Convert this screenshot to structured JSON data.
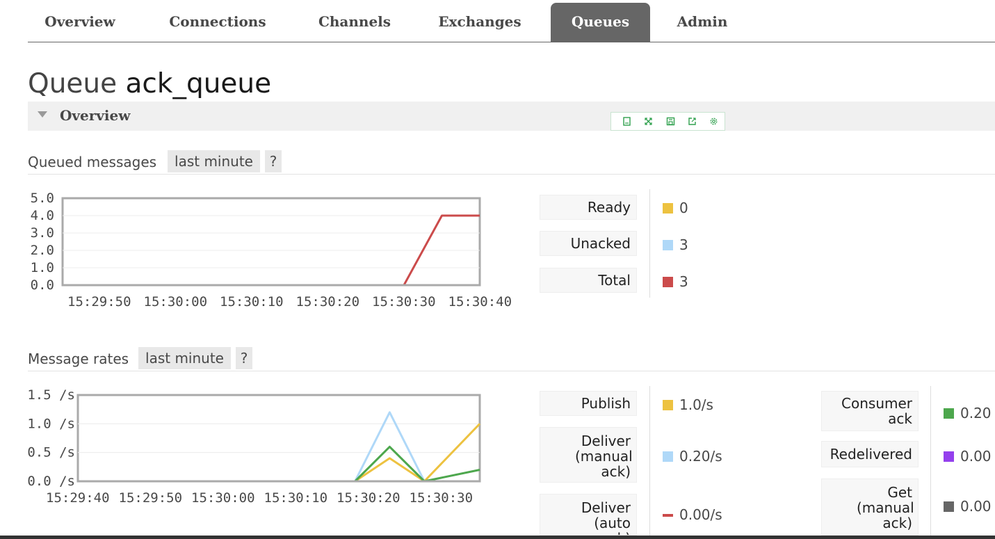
{
  "nav": {
    "tabs": [
      {
        "label": "Overview",
        "active": false
      },
      {
        "label": "Connections",
        "active": false
      },
      {
        "label": "Channels",
        "active": false
      },
      {
        "label": "Exchanges",
        "active": false
      },
      {
        "label": "Queues",
        "active": true
      },
      {
        "label": "Admin",
        "active": false
      }
    ]
  },
  "page": {
    "title_prefix": "Queue",
    "queue_name": "ack_queue"
  },
  "overview": {
    "label": "Overview",
    "toolbox_icons": [
      "data-view-icon",
      "data-zoom-icon",
      "save-image-icon",
      "restore-icon",
      "settings-icon"
    ]
  },
  "queued": {
    "name": "Queued messages",
    "range": "last minute",
    "help": "?",
    "legend": [
      {
        "label": "Ready",
        "value": "0",
        "color": "#edc240"
      },
      {
        "label": "Unacked",
        "value": "3",
        "color": "#afd8f8"
      },
      {
        "label": "Total",
        "value": "3",
        "color": "#cb4b4b"
      }
    ]
  },
  "rates": {
    "name": "Message rates",
    "range": "last minute",
    "help": "?",
    "legend_left": [
      {
        "label": "Publish",
        "value": "1.0/s",
        "color": "#edc240"
      },
      {
        "label": "Deliver (manual ack)",
        "value": "0.20/s",
        "color": "#afd8f8"
      },
      {
        "label": "Deliver (auto ack)",
        "value": "0.00/s",
        "color": "#cb4b4b"
      }
    ],
    "legend_right": [
      {
        "label": "Consumer ack",
        "value": "0.20",
        "color": "#4da74d"
      },
      {
        "label": "Redelivered",
        "value": "0.00",
        "color": "#9440ed"
      },
      {
        "label": "Get (manual ack)",
        "value": "0.00",
        "color": "#666666"
      }
    ]
  },
  "chart_data": [
    {
      "type": "line",
      "title": "Queued messages",
      "x": [
        "15:29:50",
        "15:30:00",
        "15:30:10",
        "15:30:20",
        "15:30:30",
        "15:30:40"
      ],
      "ytick_labels": [
        "0.0",
        "1.0",
        "2.0",
        "3.0",
        "4.0",
        "5.0"
      ],
      "ylim": [
        0,
        5
      ],
      "xlim_seconds": [
        0,
        55
      ],
      "series": [
        {
          "name": "Ready",
          "color": "#edc240",
          "points": [
            [
              0,
              0
            ],
            [
              45,
              0
            ],
            [
              55,
              0
            ]
          ]
        },
        {
          "name": "Total",
          "color": "#cb4b4b",
          "points": [
            [
              0,
              0
            ],
            [
              45,
              0
            ],
            [
              50,
              4
            ],
            [
              55,
              4
            ]
          ]
        }
      ]
    },
    {
      "type": "line",
      "title": "Message rates",
      "x": [
        "15:29:40",
        "15:29:50",
        "15:30:00",
        "15:30:10",
        "15:30:20",
        "15:30:30"
      ],
      "ytick_labels": [
        "0.0 /s",
        "0.5 /s",
        "1.0 /s",
        "1.5 /s"
      ],
      "ylim": [
        0,
        1.5
      ],
      "xlim_seconds": [
        0,
        58
      ],
      "series": [
        {
          "name": "Deliver (manual ack)",
          "color": "#afd8f8",
          "points": [
            [
              0,
              0
            ],
            [
              40,
              0
            ],
            [
              45,
              1.2
            ],
            [
              50,
              0
            ],
            [
              58,
              0
            ]
          ]
        },
        {
          "name": "Publish",
          "color": "#edc240",
          "points": [
            [
              0,
              0
            ],
            [
              40,
              0
            ],
            [
              45,
              0.4
            ],
            [
              50,
              0
            ],
            [
              58,
              1.0
            ]
          ]
        },
        {
          "name": "Consumer ack",
          "color": "#4da74d",
          "points": [
            [
              0,
              0
            ],
            [
              40,
              0
            ],
            [
              45,
              0.6
            ],
            [
              50,
              0
            ],
            [
              58,
              0.2
            ]
          ]
        },
        {
          "name": "Redelivered",
          "color": "#9440ed",
          "points": [
            [
              0,
              0
            ],
            [
              58,
              0
            ]
          ]
        }
      ]
    }
  ]
}
